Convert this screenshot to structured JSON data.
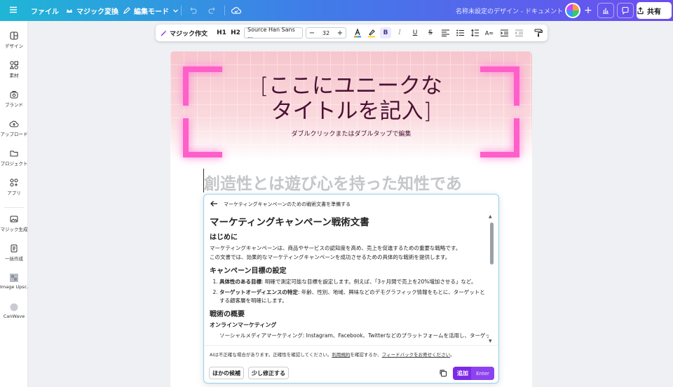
{
  "topbar": {
    "file": "ファイル",
    "magic_switch": "マジック変換",
    "edit_mode": "編集モード",
    "doc_title": "名称未設定のデザイン - ドキュメント",
    "share": "共有"
  },
  "sidebar": {
    "items": [
      {
        "label": "デザイン",
        "icon": "design-icon"
      },
      {
        "label": "素材",
        "icon": "elements-icon"
      },
      {
        "label": "ブランド",
        "icon": "brand-icon"
      },
      {
        "label": "アップロード",
        "icon": "upload-icon"
      },
      {
        "label": "プロジェクト",
        "icon": "folder-icon"
      },
      {
        "label": "アプリ",
        "icon": "apps-icon"
      },
      {
        "label": "マジック生成",
        "icon": "magic-media-icon"
      },
      {
        "label": "一括作成",
        "icon": "bulk-create-icon"
      },
      {
        "label": "Image Upsc...",
        "icon": "image-upscaler-icon"
      },
      {
        "label": "CanWave",
        "icon": "canwave-icon"
      }
    ]
  },
  "format_toolbar": {
    "magic_write": "マジック作文",
    "h1": "H1",
    "h2": "H2",
    "font": "Source Han Sans ...",
    "size": "32",
    "minus": "−",
    "plus": "+"
  },
  "canvas": {
    "title_line1": "[ここにユニークな",
    "title_line2": "タイトルを記入]",
    "subtitle": "ダブルクリックまたはダブルタップで編集",
    "body_placeholder": "創造性とは遊び心を持った知性であ"
  },
  "ai_panel": {
    "header": "マーケティングキャンペーンのための戦術文書を準備する",
    "doc_title": "マーケティングキャンペーン戦術文書",
    "intro_heading": "はじめに",
    "intro_p1": "マーケティングキャンペーンは、商品やサービスの認知度を高め、売上を促進するための重要な戦略です。",
    "intro_p2": "この文書では、効果的なマーケティングキャンペーンを成功させるための具体的な戦術を提供します。",
    "goals_heading": "キャンペーン目標の設定",
    "goal1_bold": "具体性のある目標",
    "goal1_text": ": 明確で測定可能な目標を設定します。例えば、「3ヶ月間で売上を20%増加させる」など。",
    "goal2_bold": "ターゲットオーディエンスの特定",
    "goal2_text": ": 年齢、性別、地域、興味などのデモグラフィック情報をもとに、ターゲットとする顧客層を明確にします。",
    "tactics_heading": "戦術の概要",
    "online_heading": "オンラインマーケティング",
    "cut_line": "ソーシャルメディアマーケティング: Instagram、Facebook、Twitterなどのプラットフォームを活用し、ターゲット",
    "disclaimer_text": "AIは不正確な場合があります。正確性を確認してください。",
    "disclaimer_link1": "利用規約",
    "disclaimer_mid": "を確認するか、",
    "disclaimer_link2": "フィードバックをお寄せください",
    "disclaimer_end": "。",
    "btn_other": "ほかの候補",
    "btn_modify": "少し修正する",
    "btn_add": "追加",
    "btn_add_hint": "Enter"
  },
  "colors": {
    "accent": "#7d2ae8",
    "bracket": "#ff5fc9",
    "title": "#4a1233"
  }
}
